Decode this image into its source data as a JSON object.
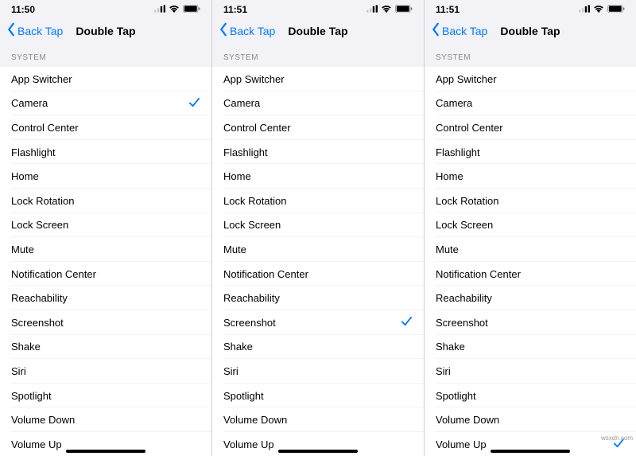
{
  "screens": [
    {
      "time": "11:50",
      "selected": "Camera"
    },
    {
      "time": "11:51",
      "selected": "Screenshot"
    },
    {
      "time": "11:51",
      "selected": "Volume Up"
    }
  ],
  "nav": {
    "back": "Back Tap",
    "title": "Double Tap"
  },
  "section": "SYSTEM",
  "items": [
    "App Switcher",
    "Camera",
    "Control Center",
    "Flashlight",
    "Home",
    "Lock Rotation",
    "Lock Screen",
    "Mute",
    "Notification Center",
    "Reachability",
    "Screenshot",
    "Shake",
    "Siri",
    "Spotlight",
    "Volume Down",
    "Volume Up"
  ],
  "watermark": "wsxdn.com"
}
